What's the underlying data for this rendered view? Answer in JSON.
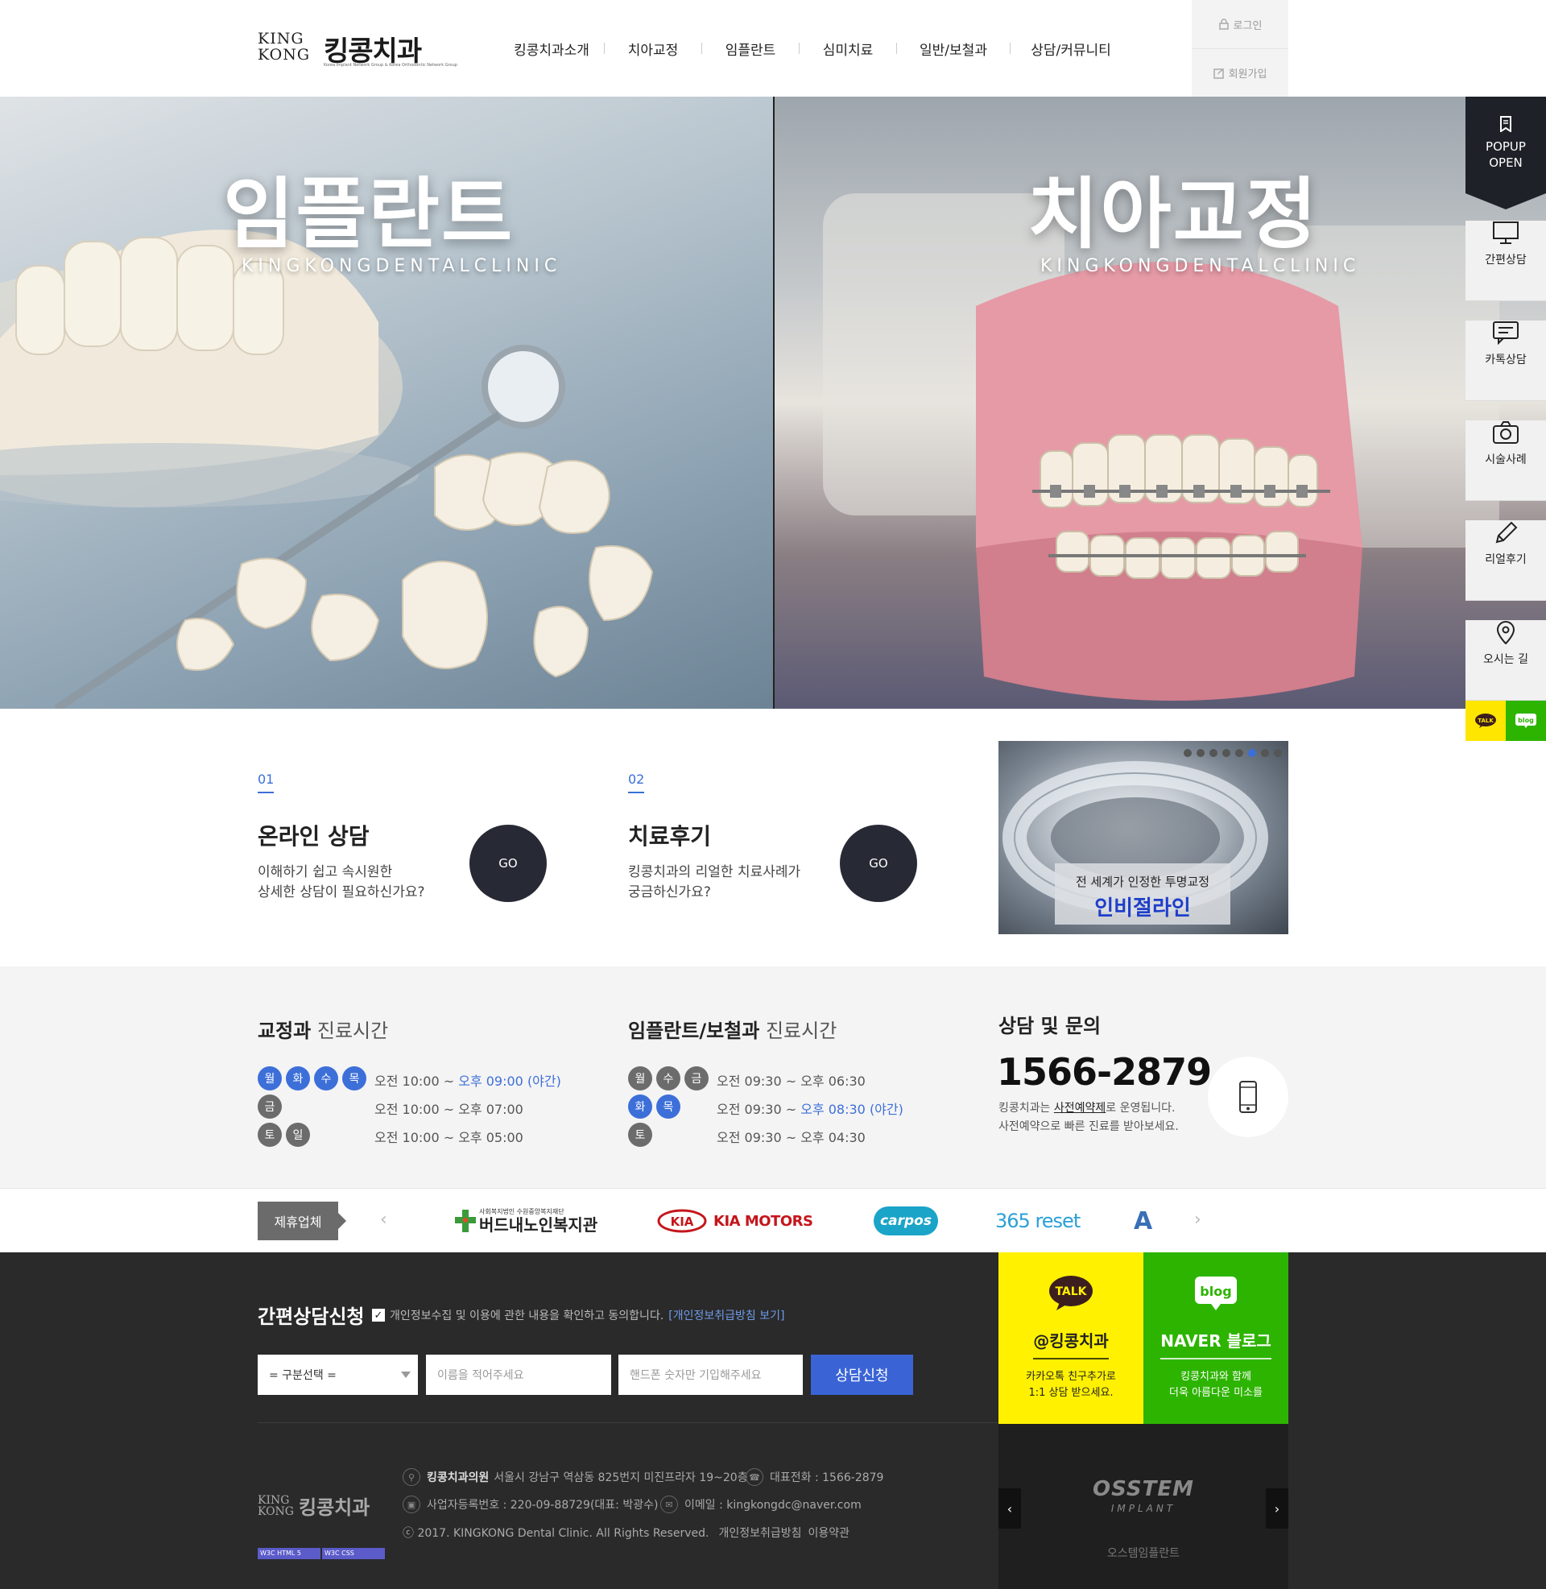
{
  "header": {
    "logo_mark": "KING KONG",
    "logo_name": "킹콩치과",
    "logo_tag": "Korea Implant Network Group & Korea Orthodontic Network Group",
    "nav": [
      "킹콩치과소개",
      "치아교정",
      "임플란트",
      "심미치료",
      "일반/보철과",
      "상담/커뮤니티"
    ],
    "login": "로그인",
    "join": "회원가입"
  },
  "hero": {
    "left_title": "임플란트",
    "left_sub": "KINGKONGDENTALCLINIC",
    "right_title": "치아교정",
    "right_sub": "KINGKONGDENTALCLINIC"
  },
  "quick": {
    "popup": [
      "POPUP",
      "OPEN"
    ],
    "items": [
      "간편상담",
      "카톡상담",
      "시술사례",
      "리얼후기",
      "오시는 길"
    ],
    "talk": "TALK",
    "blog": "blog"
  },
  "cta": [
    {
      "num": "01",
      "title": "온라인 상담",
      "desc": [
        "이해하기 쉽고 속시원한",
        "상세한 상담이 필요하신가요?"
      ],
      "go": "GO"
    },
    {
      "num": "02",
      "title": "치료후기",
      "desc": [
        "킹콩치과의 리얼한 치료사례가",
        "궁금하신가요?"
      ],
      "go": "GO"
    }
  ],
  "banner": {
    "caption_top": "전 세계가 인정한 투명교정",
    "caption_main": "인비절라인",
    "active_dot": 6,
    "dot_count": 8
  },
  "hours": {
    "ortho": {
      "title_bold": "교정과",
      "title_rest": "진료시간",
      "rows": [
        {
          "days": [
            "월",
            "화",
            "수",
            "목"
          ],
          "color": "blue",
          "time": "오전 10:00 ~ ",
          "time_hl": "오후 09:00 (야간)"
        },
        {
          "days": [
            "금"
          ],
          "color": "gray",
          "time": "오전 10:00 ~ 오후 07:00",
          "time_hl": ""
        },
        {
          "days": [
            "토",
            "일"
          ],
          "color": "gray",
          "time": "오전 10:00 ~ 오후 05:00",
          "time_hl": ""
        }
      ]
    },
    "implant": {
      "title_bold": "임플란트/보철과",
      "title_rest": "진료시간",
      "rows": [
        {
          "days": [
            "월",
            "수",
            "금"
          ],
          "color": "gray",
          "time": "오전 09:30 ~ 오후 06:30",
          "time_hl": ""
        },
        {
          "days": [
            "화",
            "목"
          ],
          "color": "blue",
          "time": "오전 09:30 ~ ",
          "time_hl": "오후 08:30 (야간)"
        },
        {
          "days": [
            "토"
          ],
          "color": "gray",
          "time": "오전 09:30 ~ 오후 04:30",
          "time_hl": ""
        }
      ]
    },
    "contact": {
      "title": "상담 및 문의",
      "phone": "1566-2879",
      "desc1_a": "킹콩치과는 ",
      "desc1_b": "사전예약제",
      "desc1_c": "로 운영됩니다.",
      "desc2": "사전예약으로 빠른 진료를 받아보세요."
    }
  },
  "partners": {
    "label": "제휴업체",
    "logos": [
      {
        "small": "사회복지법인 수원중앙복지재단",
        "main": "버드내노인복지관"
      },
      {
        "main": "KIA MOTORS"
      },
      {
        "main": "carpos"
      },
      {
        "main": "365 reset"
      },
      {
        "main": "A"
      }
    ]
  },
  "footer": {
    "form_title": "간편상담신청",
    "agree_text": "개인정보수집 및 이용에 관한 내용을 확인하고 동의합니다.",
    "agree_link": "[개인정보취급방침 보기]",
    "select_value": "= 구분선택 =",
    "name_placeholder": "이름을 적어주세요",
    "phone_placeholder": "핸드폰 숫자만 기입해주세요",
    "submit": "상담신청",
    "clinic_name": "킹콩치과의원",
    "address": "서울시 강남구 역삼동 825번지 미진프라자 19~20층",
    "tel": "대표전화 : 1566-2879",
    "biz": "사업자등록번호 : 220-09-88729(대표: 박광수)",
    "email": "이메일 : kingkongdc@naver.com",
    "copyright": "ⓒ 2017. KINGKONG Dental Clinic. All Rights Reserved.",
    "privacy": "개인정보취급방침",
    "terms": "이용약관",
    "logo_mark": "KING KONG",
    "logo_name": "킹콩치과",
    "w3c": [
      "W3C HTML 5",
      "W3C CSS"
    ]
  },
  "sns": {
    "kakao": {
      "icon": "TALK",
      "name": "@킹콩치과",
      "desc": [
        "카카오톡 친구추가로",
        "1:1 상담 받으세요."
      ]
    },
    "naver": {
      "icon": "blog",
      "name": "NAVER 블로그",
      "desc": [
        "킹콩치과와 함께",
        "더욱 아름다운 미소를"
      ]
    }
  },
  "osstem": {
    "logo": "OSSTEM",
    "logo_sub": "IMPLANT",
    "caption": "오스템임플란트"
  },
  "colors": {
    "accent_blue": "#3d6fd9",
    "dark": "#272a35",
    "kakao_yellow": "#fff100",
    "naver_green": "#2db400"
  }
}
